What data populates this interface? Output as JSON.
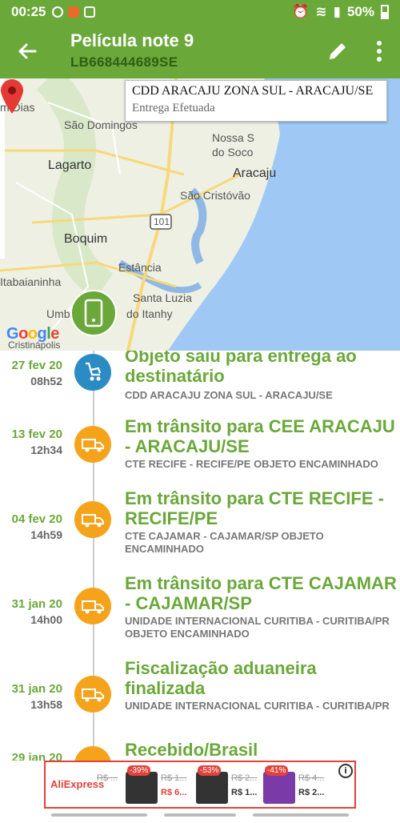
{
  "status_bar": {
    "time": "00:25",
    "battery": "50%"
  },
  "header": {
    "title": "Película note 9",
    "tracking_code": "LB668444689SE"
  },
  "map": {
    "callout_title": "CDD ARACAJU ZONA SUL - ARACAJU/SE",
    "callout_status": "Entrega Efetuada",
    "labels": {
      "dias": "m Dias",
      "sao_domingos": "São Domingos",
      "lagarto": "Lagarto",
      "nossa_1": "Nossa S",
      "nossa_2": "do Soco",
      "aracaju": "Aracaju",
      "sao_cristovao": "São Cristóvão",
      "road": "101",
      "boquim": "Boquim",
      "estancia": "Estância",
      "itabaianinha": "Itabaianinha",
      "santa_luzia": "Santa Luzia",
      "itanhy": "do Itanhy",
      "umba": "Umba",
      "cristinapolis": "Cristinápolis"
    },
    "google": [
      "G",
      "o",
      "o",
      "g",
      "l",
      "e"
    ]
  },
  "events": [
    {
      "date": "27 fev 20",
      "time": "08h52",
      "title": "Objeto saiu para entrega ao destinatário",
      "detail": "CDD ARACAJU ZONA SUL - ARACAJU/SE",
      "icon": "delivery-cart-icon"
    },
    {
      "date": "13 fev 20",
      "time": "12h34",
      "title": "Em trânsito para CEE ARACAJU - ARACAJU/SE",
      "detail": "CTE RECIFE - RECIFE/PE OBJETO ENCAMINHADO",
      "icon": "truck-icon"
    },
    {
      "date": "04 fev 20",
      "time": "14h59",
      "title": "Em trânsito para CTE RECIFE - RECIFE/PE",
      "detail": "CTE CAJAMAR - CAJAMAR/SP OBJETO ENCAMINHADO",
      "icon": "truck-icon"
    },
    {
      "date": "31 jan 20",
      "time": "14h00",
      "title": "Em trânsito para CTE CAJAMAR - CAJAMAR/SP",
      "detail": "UNIDADE INTERNACIONAL CURITIBA - CURITIBA/PR OBJETO ENCAMINHADO",
      "icon": "truck-icon"
    },
    {
      "date": "31 jan 20",
      "time": "13h58",
      "title": "Fiscalização aduaneira finalizada",
      "detail": "UNIDADE INTERNACIONAL CURITIBA - CURITIBA/PR",
      "icon": "truck-icon"
    },
    {
      "date": "29 jan 20",
      "time": "",
      "title": "Recebido/Brasil",
      "detail": "",
      "icon": "truck-icon"
    }
  ],
  "ad": {
    "brand": "AliExpress",
    "items": [
      {
        "tag": "",
        "old": "R$ ...",
        "new": ""
      },
      {
        "tag": "-39%",
        "old": "R$ 1...",
        "new": "R$ 6..."
      },
      {
        "tag": "-53%",
        "old": "R$ 2...",
        "new": "R$ 1..."
      },
      {
        "tag": "-41%",
        "old": "R$ 4...",
        "new": "R$ 2..."
      }
    ]
  },
  "colors": {
    "primary": "#6aa83a",
    "dark_green": "#2f5e12",
    "orange": "#f5a31b",
    "blue": "#2b8cc4",
    "sea": "#9fc9f4",
    "pin": "#e53935"
  }
}
